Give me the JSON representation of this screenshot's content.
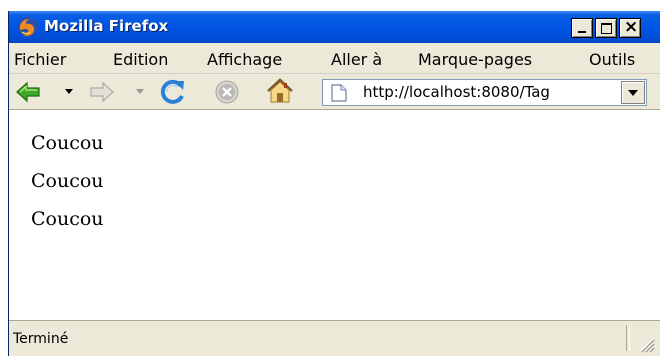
{
  "window": {
    "title": "Mozilla Firefox"
  },
  "title_buttons": {
    "minimize": "minimize-icon",
    "maximize": "maximize-icon",
    "close": "close-icon",
    "close_glyph": "×"
  },
  "menu": [
    {
      "label": "Fichier"
    },
    {
      "label": "Edition"
    },
    {
      "label": "Affichage"
    },
    {
      "label": "Aller à"
    },
    {
      "label": "Marque-pages"
    },
    {
      "label": "Outils"
    }
  ],
  "toolbar": {
    "back_icon": "back-arrow-icon",
    "forward_icon": "forward-arrow-icon",
    "reload_icon": "reload-icon",
    "stop_icon": "stop-icon",
    "home_icon": "home-icon",
    "url": "http://localhost:8080/Tag",
    "colors": {
      "back": "#3faa2a",
      "reload": "#2a7fd6",
      "stop": "#b8b8b8"
    }
  },
  "content": {
    "lines": [
      "Coucou",
      "Coucou",
      "Coucou"
    ]
  },
  "status": {
    "text": "Terminé"
  }
}
